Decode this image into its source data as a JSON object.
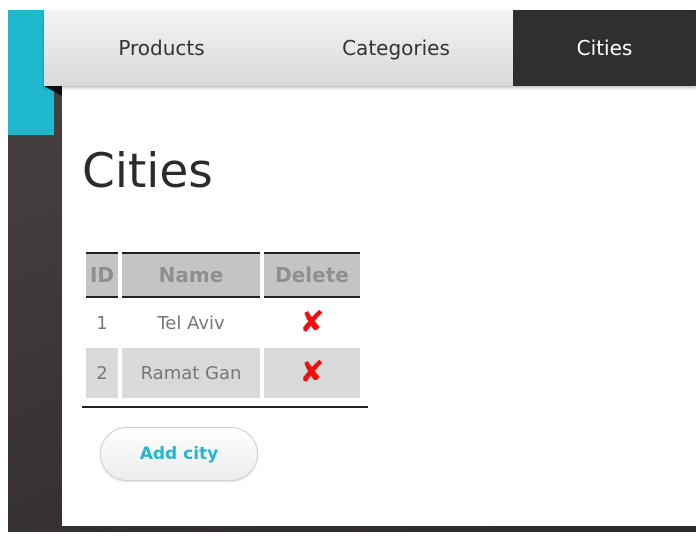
{
  "nav": {
    "tabs": [
      {
        "label": "Products",
        "active": false
      },
      {
        "label": "Categories",
        "active": false
      },
      {
        "label": "Cities",
        "active": true
      }
    ]
  },
  "page": {
    "title": "Cities"
  },
  "table": {
    "headers": {
      "id": "ID",
      "name": "Name",
      "delete": "Delete"
    },
    "rows": [
      {
        "id": "1",
        "name": "Tel Aviv",
        "delete_icon": "✘"
      },
      {
        "id": "2",
        "name": "Ramat Gan",
        "delete_icon": "✘"
      }
    ]
  },
  "actions": {
    "add_label": "Add city"
  },
  "icons": {
    "delete": "delete-x-icon"
  },
  "colors": {
    "accent": "#1fb8cd",
    "delete": "#ee1010",
    "nav_active_bg": "#2f2f2f",
    "background_dark": "#3a3435"
  }
}
